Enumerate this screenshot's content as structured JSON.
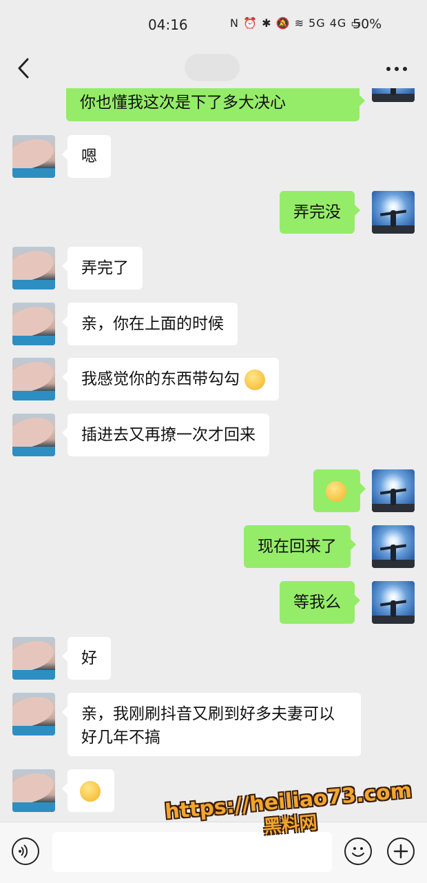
{
  "status_bar": {
    "time": "04:16",
    "icons_text": "N ⏰ ✱ 🔕 ≋ 5G 4G ▭",
    "battery": "50%"
  },
  "header": {
    "back_icon": "chevron-left-icon",
    "more_icon": "more-dots-icon"
  },
  "messages": [
    {
      "side": "right",
      "text": "你也懂我这次是下了多大决心"
    },
    {
      "side": "left",
      "text": "嗯"
    },
    {
      "side": "right",
      "text": "弄完没"
    },
    {
      "side": "left",
      "text": "弄完了"
    },
    {
      "side": "left",
      "text": "亲，你在上面的时候"
    },
    {
      "side": "left",
      "text": "我感觉你的东西带勾勾"
    },
    {
      "side": "left",
      "text": "插进去又再撩一次才回来"
    },
    {
      "side": "right",
      "text": ""
    },
    {
      "side": "right",
      "text": "现在回来了"
    },
    {
      "side": "right",
      "text": "等我么"
    },
    {
      "side": "left",
      "text": "好"
    },
    {
      "side": "left",
      "text": "亲，我刚刷抖音又刷到好多夫妻可以好几年不搞"
    },
    {
      "side": "left",
      "text": ""
    }
  ],
  "input": {
    "placeholder": ""
  },
  "watermark": {
    "url": "https://heiliao73.com",
    "name": "黑料网"
  },
  "colors": {
    "self_bubble": "#95ec69",
    "other_bubble": "#ffffff",
    "background": "#ededed"
  }
}
